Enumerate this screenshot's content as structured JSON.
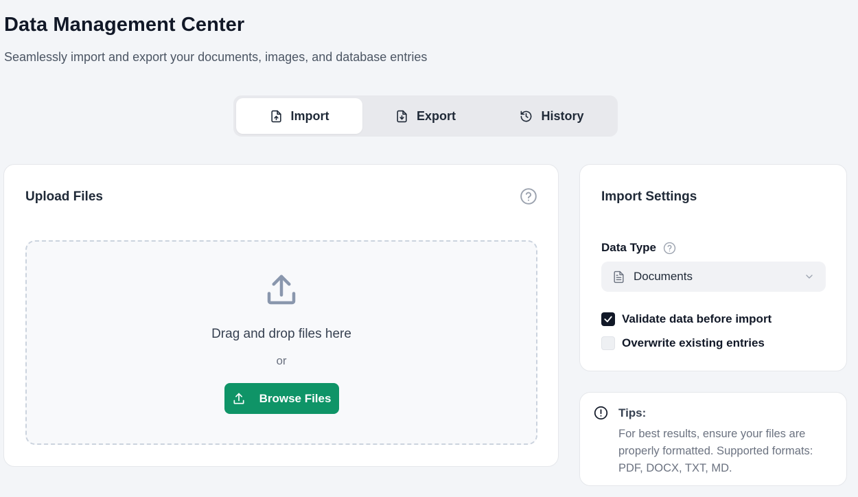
{
  "header": {
    "title": "Data Management Center",
    "subtitle": "Seamlessly import and export your documents, images, and database entries"
  },
  "tabs": [
    {
      "label": "Import",
      "icon": "file-upload-icon",
      "active": true
    },
    {
      "label": "Export",
      "icon": "file-download-icon",
      "active": false
    },
    {
      "label": "History",
      "icon": "history-icon",
      "active": false
    }
  ],
  "upload": {
    "title": "Upload Files",
    "drop_text": "Drag and drop files here",
    "or_text": "or",
    "browse_label": "Browse Files"
  },
  "settings": {
    "title": "Import Settings",
    "data_type_label": "Data Type",
    "data_type_value": "Documents",
    "validate_label": "Validate data before import",
    "validate_checked": true,
    "overwrite_label": "Overwrite existing entries",
    "overwrite_checked": false
  },
  "tips": {
    "title": "Tips:",
    "body": "For best results, ensure your files are properly formatted. Supported formats: PDF, DOCX, TXT, MD."
  },
  "colors": {
    "accent": "#0f9467",
    "background": "#f3f5f8",
    "checkbox_checked": "#111827"
  }
}
